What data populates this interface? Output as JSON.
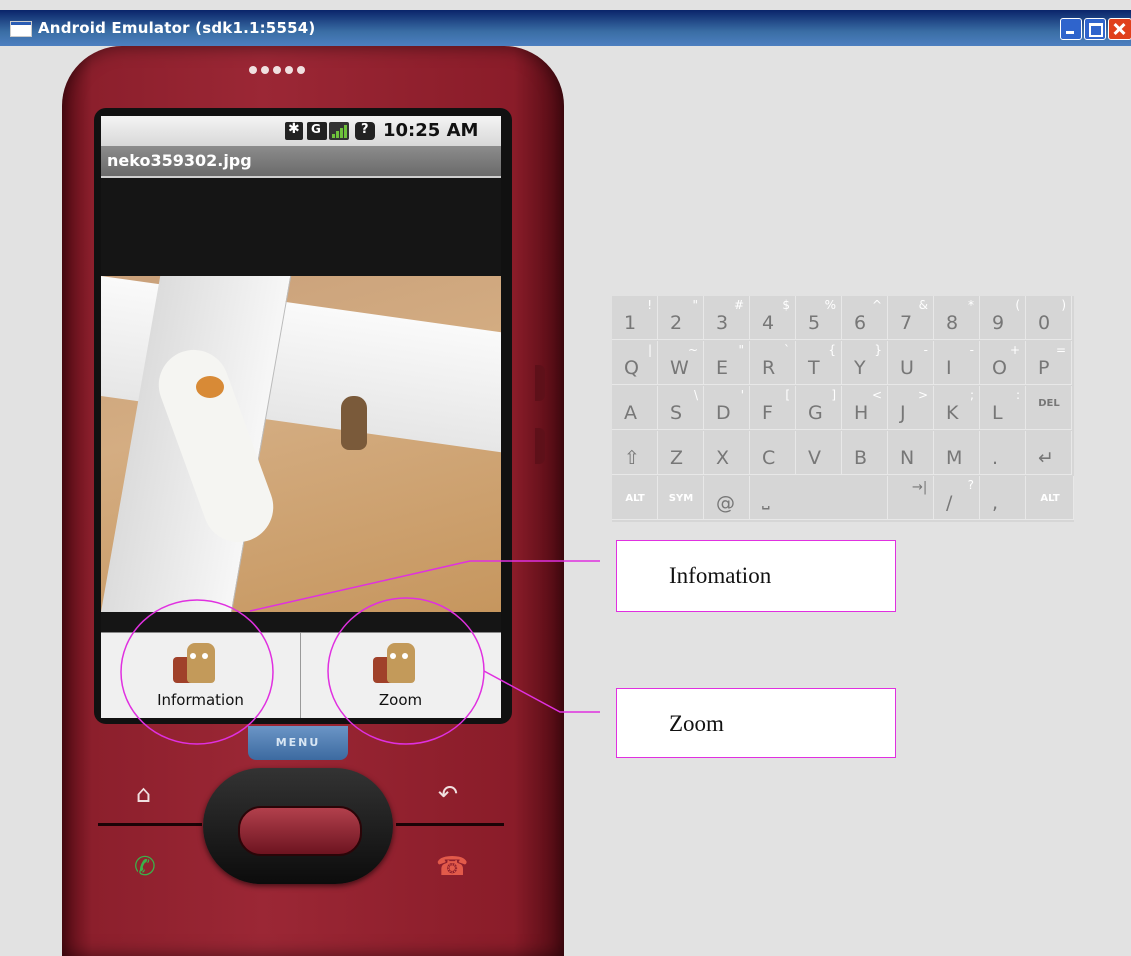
{
  "window": {
    "title": "Android Emulator (sdk1.1:5554)"
  },
  "status_bar": {
    "time": "10:25 AM"
  },
  "app": {
    "title": "neko359302.jpg"
  },
  "menu": {
    "items": [
      {
        "label": "Information",
        "icon": "cat-and-dog-icon"
      },
      {
        "label": "Zoom",
        "icon": "cat-and-dog-icon"
      }
    ]
  },
  "hardware": {
    "menu_key": "MENU"
  },
  "keyboard": {
    "row1": [
      {
        "main": "1",
        "alt": "!"
      },
      {
        "main": "2",
        "alt": "\""
      },
      {
        "main": "3",
        "alt": "#"
      },
      {
        "main": "4",
        "alt": "$"
      },
      {
        "main": "5",
        "alt": "%"
      },
      {
        "main": "6",
        "alt": "^"
      },
      {
        "main": "7",
        "alt": "&"
      },
      {
        "main": "8",
        "alt": "*"
      },
      {
        "main": "9",
        "alt": "("
      },
      {
        "main": "0",
        "alt": ")"
      }
    ],
    "row2": [
      {
        "main": "Q",
        "alt": "|"
      },
      {
        "main": "W",
        "alt": "~"
      },
      {
        "main": "E",
        "alt": "\""
      },
      {
        "main": "R",
        "alt": "`"
      },
      {
        "main": "T",
        "alt": "{"
      },
      {
        "main": "Y",
        "alt": "}"
      },
      {
        "main": "U",
        "alt": "-"
      },
      {
        "main": "I",
        "alt": "-"
      },
      {
        "main": "O",
        "alt": "+"
      },
      {
        "main": "P",
        "alt": "="
      }
    ],
    "row3": [
      {
        "main": "A",
        "alt": ""
      },
      {
        "main": "S",
        "alt": "\\"
      },
      {
        "main": "D",
        "alt": "'"
      },
      {
        "main": "F",
        "alt": "["
      },
      {
        "main": "G",
        "alt": "]"
      },
      {
        "main": "H",
        "alt": "<"
      },
      {
        "main": "J",
        "alt": ">"
      },
      {
        "main": "K",
        "alt": ";"
      },
      {
        "main": "L",
        "alt": ":"
      },
      {
        "main": "DEL",
        "alt": ""
      }
    ],
    "row4": [
      {
        "main": "⇧",
        "alt": ""
      },
      {
        "main": "Z",
        "alt": ""
      },
      {
        "main": "X",
        "alt": ""
      },
      {
        "main": "C",
        "alt": ""
      },
      {
        "main": "V",
        "alt": ""
      },
      {
        "main": "B",
        "alt": ""
      },
      {
        "main": "N",
        "alt": ""
      },
      {
        "main": "M",
        "alt": ""
      },
      {
        "main": ".",
        "alt": ""
      },
      {
        "main": "↵",
        "alt": ""
      }
    ],
    "row5": [
      {
        "main": "ALT"
      },
      {
        "main": "SYM"
      },
      {
        "main": "@"
      },
      {
        "main": "⎵"
      },
      {
        "main": "→|"
      },
      {
        "main": "/",
        "alt": "?"
      },
      {
        "main": ","
      },
      {
        "main": "ALT"
      }
    ]
  },
  "callouts": {
    "information": "Infomation",
    "zoom": "Zoom"
  },
  "colors": {
    "annotation": "#e030e0",
    "phone_body": "#9b2735",
    "title_bar": "#0a246a"
  }
}
